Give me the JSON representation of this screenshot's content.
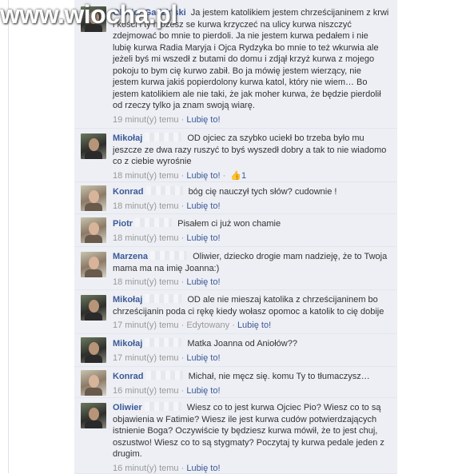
{
  "watermark": "www.wiocha.pl",
  "comments": [
    {
      "name": "Oliwier Gadziński",
      "text": "Ja jestem katolikiem jestem chrześcijaninem z krwi i kości i ty możesz se kurwa krzyczeć na ulicy kurwa niszczyć zdejmować bo mnie to pierdoli. Ja nie jestem kurwa pedałem i nie lubię kurwa Radia Maryja i Ojca Rydzyka bo mnie to też wkurwia ale jeżeli byś mi wszedł z butami do domu i zdjął krzyż kurwa z mojego pokoju to bym cię kurwo zabił. Bo ja mówię jestem wierzący, nie jestem kurwa jakiś popierdolony kurwa katol, który nie wiem… Bo jestem katolikiem ale nie taki, że jak moher kurwa, że będzie pierdolił od rzeczy tylko ja znam swoją wiarę.",
      "time": "19 minut(y) temu",
      "sep": "·",
      "like": "Lubię to!"
    },
    {
      "name": "Mikołaj",
      "text": "OD ojciec za szybko uciekł bo trzeba było mu jeszcze ze dwa razy ruszyć to byś wyszedł dobry a tak to nie wiadomo co z ciebie wyrośnie",
      "time": "18 minut(y) temu",
      "sep": "·",
      "like": "Lubię to!",
      "likes": "1"
    },
    {
      "name": "Konrad",
      "text": "bóg cię nauczył tych słów? cudownie !",
      "time": "18 minut(y) temu",
      "sep": "·",
      "like": "Lubię to!"
    },
    {
      "name": "Piotr",
      "text": "Pisałem ci już won chamie",
      "time": "18 minut(y) temu",
      "sep": "·",
      "like": "Lubię to!"
    },
    {
      "name": "Marzena",
      "text": "Oliwier, dziecko drogie mam nadzieję, że to Twoja mama ma na imię Joanna:)",
      "time": "18 minut(y) temu",
      "sep": "·",
      "like": "Lubię to!"
    },
    {
      "name": "Mikołaj",
      "text": "OD ale nie mieszaj katolika z chrześcijaninem bo chrześcijanin poda ci rękę kiedy wołasz opomoc a katolik to cię dobije",
      "time": "17 minut(y) temu",
      "sep": "·",
      "edited": "Edytowany",
      "like": "Lubię to!"
    },
    {
      "name": "Mikołaj",
      "text": "Matka Joanna od Aniołów??",
      "time": "17 minut(y) temu",
      "sep": "·",
      "like": "Lubię to!"
    },
    {
      "name": "Konrad",
      "text": "Michał, nie męcz się. komu Ty to tłumaczysz…",
      "time": "16 minut(y) temu",
      "sep": "·",
      "like": "Lubię to!"
    },
    {
      "name": "Oliwier",
      "text": "Wiesz co to jest kurwa Ojciec Pio? Wiesz co to są objawienia w Fatimie? Wiesz ile jest kurwa cudów potwierdzających istnienie Boga? Oczywiście ty będziesz kurwa mówił, że to jest chuj, oszustwo! Wiesz co to są stygmaty? Poczytaj ty kurwa pedale jeden z drugim.",
      "time": "16 minut(y) temu",
      "sep": "·",
      "like": "Lubię to!"
    }
  ]
}
